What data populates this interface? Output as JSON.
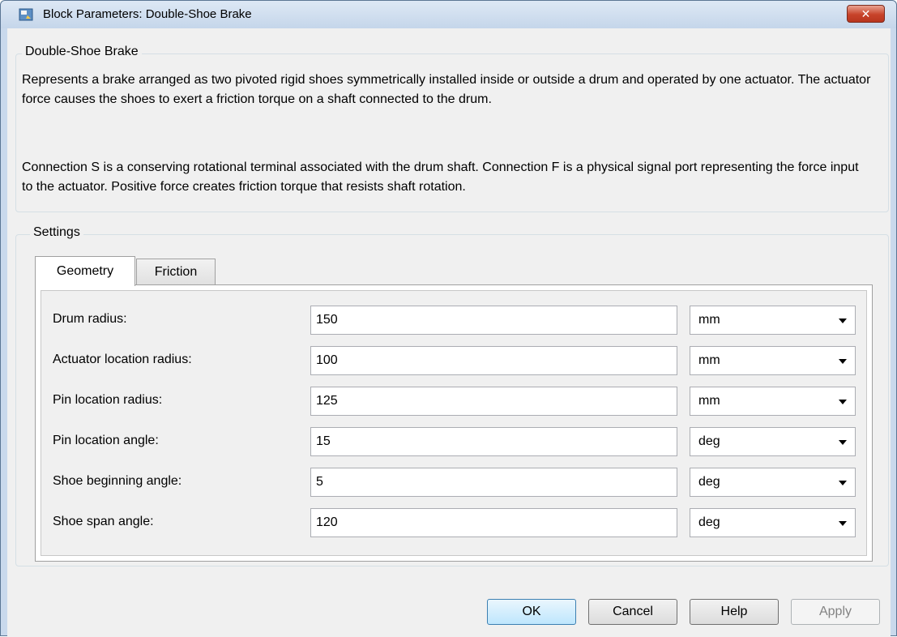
{
  "window": {
    "title": "Block Parameters: Double-Shoe Brake",
    "close_glyph": "✕"
  },
  "block": {
    "legend": "Double-Shoe Brake",
    "description_1": "Represents a brake arranged as two pivoted rigid shoes symmetrically installed inside or outside a drum and operated by one actuator. The actuator force causes the shoes to exert a friction torque on a shaft connected to the drum.",
    "description_2": "Connection S is a conserving rotational terminal associated with the drum shaft. Connection F is a physical signal port representing the force input to the actuator. Positive force creates friction torque that resists shaft rotation."
  },
  "settings": {
    "legend": "Settings",
    "tabs": [
      {
        "label": "Geometry",
        "active": true
      },
      {
        "label": "Friction",
        "active": false
      }
    ],
    "params": [
      {
        "label": "Drum radius:",
        "value": "150",
        "unit": "mm"
      },
      {
        "label": "Actuator location radius:",
        "value": "100",
        "unit": "mm"
      },
      {
        "label": "Pin location radius:",
        "value": "125",
        "unit": "mm"
      },
      {
        "label": "Pin location angle:",
        "value": "15",
        "unit": "deg"
      },
      {
        "label": "Shoe beginning angle:",
        "value": "5",
        "unit": "deg"
      },
      {
        "label": "Shoe span angle:",
        "value": "120",
        "unit": "deg"
      }
    ]
  },
  "buttons": {
    "ok": "OK",
    "cancel": "Cancel",
    "help": "Help",
    "apply": "Apply"
  },
  "colors": {
    "title_bar": "#c5d6ea",
    "close_button": "#c7432a",
    "default_button": "#bee6fd"
  },
  "icons": {
    "title": "simulink-block-icon",
    "close": "close-icon",
    "dropdown": "chevron-down-icon"
  }
}
